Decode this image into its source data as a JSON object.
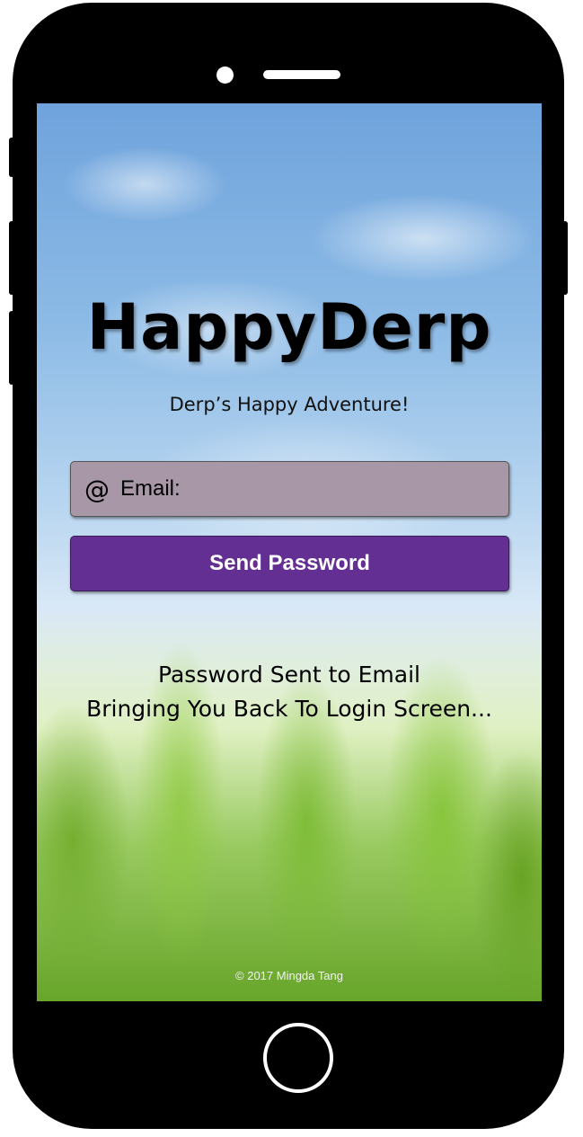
{
  "app": {
    "title": "HappyDerp",
    "subtitle": "Derp’s Happy Adventure!"
  },
  "form": {
    "email_icon": "@",
    "email_placeholder": "Email:",
    "email_value": "",
    "send_button_label": "Send Password"
  },
  "status": {
    "line1": "Password Sent to Email",
    "line2": "Bringing You Back To Login Screen..."
  },
  "footer": {
    "copyright": "© 2017 Mingda Tang"
  },
  "colors": {
    "email_field_bg": "#a897a7",
    "button_bg": "#632f93",
    "phone_frame": "#000000"
  },
  "icons": {
    "email": "at-icon"
  }
}
